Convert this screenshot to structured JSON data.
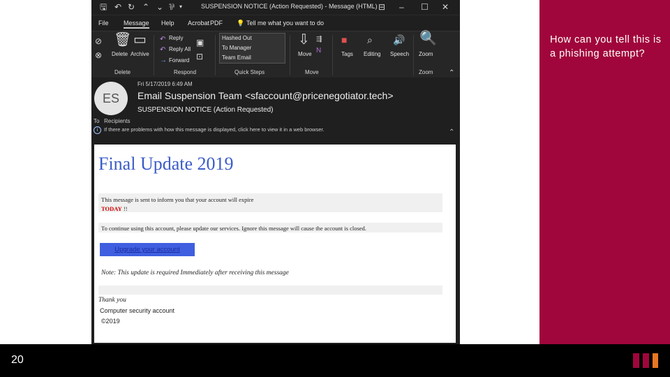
{
  "slide": {
    "question": "How can you tell this is a phishing attempt?",
    "number": "20",
    "logo_colors": [
      "#a0063b",
      "#a0063b",
      "#e87722"
    ]
  },
  "window": {
    "title": "SUSPENSION NOTICE (Action Requested) - Message (HTML)",
    "menu": [
      "File",
      "Message",
      "Help",
      "Acrobat",
      "PDF"
    ],
    "tell_me": "Tell me what you want to do"
  },
  "ribbon": {
    "delete_label": "Delete",
    "archive_label": "Archive",
    "reply_label": "Reply",
    "reply_all_label": "Reply All",
    "forward_label": "Forward",
    "quick_steps": [
      "Hashed Out",
      "To Manager",
      "Team Email"
    ],
    "move_label": "Move",
    "tags_label": "Tags",
    "editing_label": "Editing",
    "speech_label": "Speech",
    "zoom_label": "Zoom",
    "groups": {
      "delete": "Delete",
      "respond": "Respond",
      "quick_steps": "Quick Steps",
      "move": "Move",
      "zoom": "Zoom"
    }
  },
  "header": {
    "avatar_initials": "ES",
    "date": "Fri 5/17/2019 6:49 AM",
    "sender": "Email Suspension Team <sfaccount@pricenegotiator.tech>",
    "subject": "SUSPENSION NOTICE (Action Requested)",
    "to_label": "To",
    "recipients": "Recipients",
    "info_text": "If there are problems with how this message is displayed, click here to view it in a web browser."
  },
  "email": {
    "heading": "Final Update 2019",
    "line1": "This message is sent to inform you that your account will expire",
    "today": "TODAY",
    "today_suffix": " !!",
    "line2": "To continue using this account, please update our services. Ignore this message will cause the account is closed.",
    "button": "Upgrade your account",
    "note": "Note: This update is required Immediately after receiving this message",
    "thank_you": "Thank you",
    "signature": "Computer security account",
    "copyright": "©2019"
  },
  "colors": {
    "accent": "#a0063b",
    "heading_blue": "#3b5cc8",
    "button_blue": "#3f5fe0",
    "warning_red": "#cc0000"
  }
}
